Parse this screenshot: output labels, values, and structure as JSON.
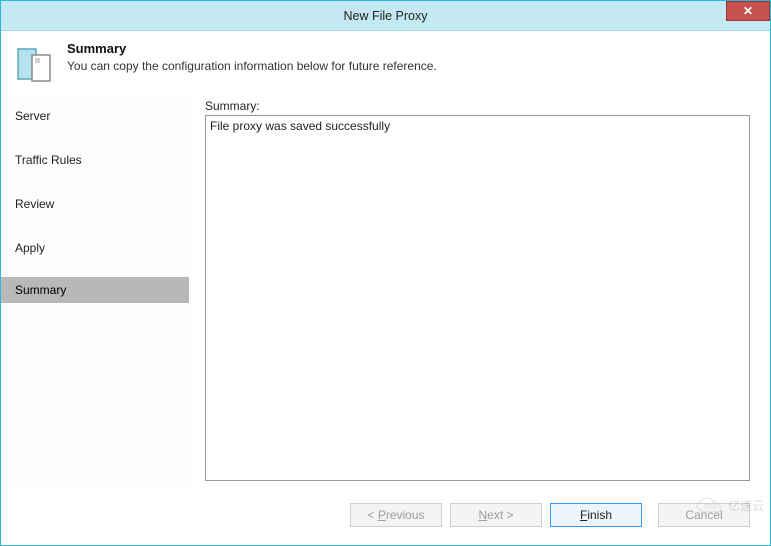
{
  "window": {
    "title": "New File Proxy",
    "close_glyph": "✕"
  },
  "header": {
    "heading": "Summary",
    "subtext": "You can copy the configuration information below for future reference."
  },
  "sidebar": {
    "steps": [
      {
        "label": "Server"
      },
      {
        "label": "Traffic Rules"
      },
      {
        "label": "Review"
      },
      {
        "label": "Apply"
      },
      {
        "label": "Summary",
        "current": true
      }
    ]
  },
  "main": {
    "summary_label": "Summary:",
    "summary_text": "File proxy was saved successfully"
  },
  "footer": {
    "previous_prefix": "< ",
    "previous_mn": "P",
    "previous_rest": "revious",
    "next_mn": "N",
    "next_rest": "ext >",
    "finish_mn": "F",
    "finish_rest": "inish",
    "cancel_label": "Cancel",
    "previous_disabled": true,
    "next_disabled": true,
    "finish_disabled": false,
    "cancel_disabled": true
  },
  "watermark": {
    "text": "亿速云"
  }
}
